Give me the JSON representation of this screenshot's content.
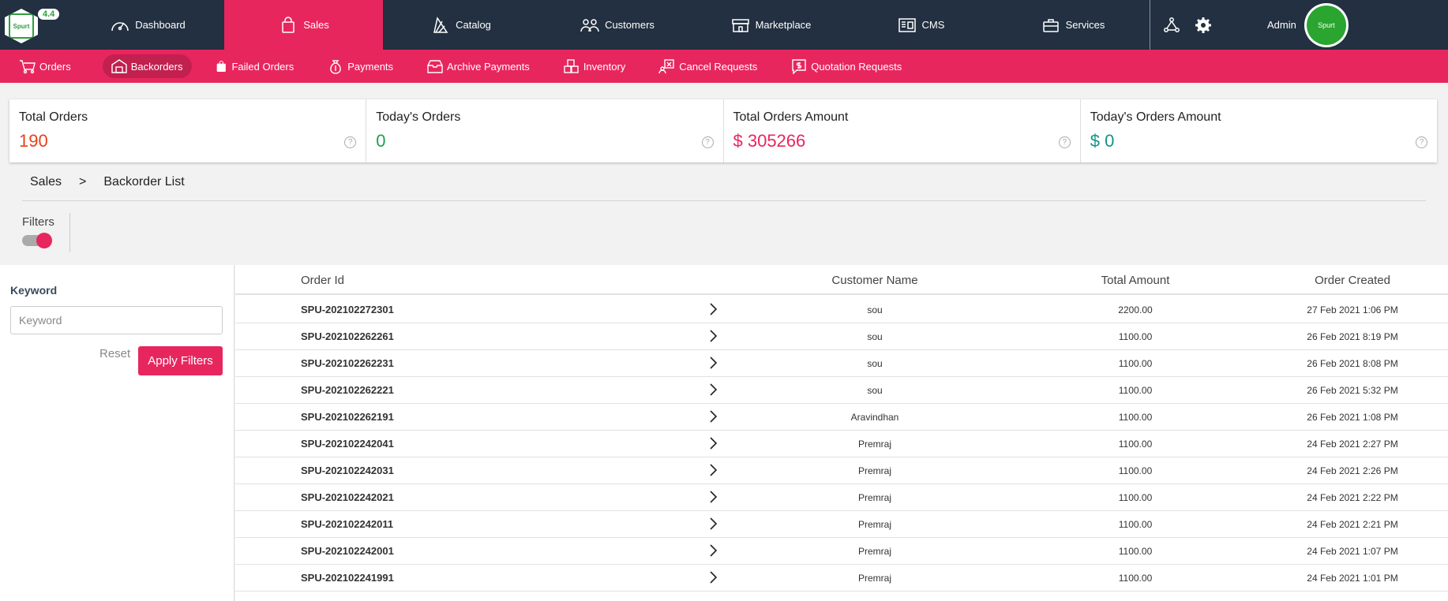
{
  "app": {
    "version": "4.4",
    "logo_text": "Spurt"
  },
  "topnav": {
    "items": [
      {
        "label": "Dashboard",
        "icon": "speedometer-icon"
      },
      {
        "label": "Sales",
        "icon": "shopping-bag-icon",
        "active": true
      },
      {
        "label": "Catalog",
        "icon": "catalog-icon"
      },
      {
        "label": "Customers",
        "icon": "users-icon"
      },
      {
        "label": "Marketplace",
        "icon": "store-icon"
      },
      {
        "label": "CMS",
        "icon": "cms-icon"
      },
      {
        "label": "Services",
        "icon": "briefcase-icon"
      }
    ],
    "user": {
      "name": "Admin"
    }
  },
  "subnav": {
    "items": [
      {
        "label": "Orders",
        "icon": "cart-icon"
      },
      {
        "label": "Backorders",
        "icon": "warehouse-icon",
        "active": true
      },
      {
        "label": "Failed Orders",
        "icon": "bag-icon"
      },
      {
        "label": "Payments",
        "icon": "money-bag-icon"
      },
      {
        "label": "Archive Payments",
        "icon": "archive-icon"
      },
      {
        "label": "Inventory",
        "icon": "boxes-icon"
      },
      {
        "label": "Cancel Requests",
        "icon": "cancel-request-icon"
      },
      {
        "label": "Quotation Requests",
        "icon": "quotation-icon"
      }
    ]
  },
  "stats": [
    {
      "label": "Total Orders",
      "value": "190",
      "color": "#e8401c"
    },
    {
      "label": "Today's Orders",
      "value": "0",
      "color": "#1aa34a"
    },
    {
      "label": "Total Orders Amount",
      "value": "$ 305266",
      "color": "#e8265e"
    },
    {
      "label": "Today's Orders Amount",
      "value": "$ 0",
      "color": "#14948a"
    }
  ],
  "breadcrumb": {
    "root": "Sales",
    "separator": ">",
    "current": "Backorder List"
  },
  "filters": {
    "toggle_label": "Filters",
    "keyword_label": "Keyword",
    "keyword_placeholder": "Keyword",
    "reset_label": "Reset",
    "apply_label": "Apply Filters"
  },
  "table": {
    "columns": [
      "Order Id",
      "Customer Name",
      "Total Amount",
      "Order Created"
    ],
    "rows": [
      {
        "id": "SPU-202102272301",
        "customer": "sou",
        "amount": "2200.00",
        "created": "27 Feb 2021 1:06 PM"
      },
      {
        "id": "SPU-202102262261",
        "customer": "sou",
        "amount": "1100.00",
        "created": "26 Feb 2021 8:19 PM"
      },
      {
        "id": "SPU-202102262231",
        "customer": "sou",
        "amount": "1100.00",
        "created": "26 Feb 2021 8:08 PM"
      },
      {
        "id": "SPU-202102262221",
        "customer": "sou",
        "amount": "1100.00",
        "created": "26 Feb 2021 5:32 PM"
      },
      {
        "id": "SPU-202102262191",
        "customer": "Aravindhan",
        "amount": "1100.00",
        "created": "26 Feb 2021 1:08 PM"
      },
      {
        "id": "SPU-202102242041",
        "customer": "Premraj",
        "amount": "1100.00",
        "created": "24 Feb 2021 2:27 PM"
      },
      {
        "id": "SPU-202102242031",
        "customer": "Premraj",
        "amount": "1100.00",
        "created": "24 Feb 2021 2:26 PM"
      },
      {
        "id": "SPU-202102242021",
        "customer": "Premraj",
        "amount": "1100.00",
        "created": "24 Feb 2021 2:22 PM"
      },
      {
        "id": "SPU-202102242011",
        "customer": "Premraj",
        "amount": "1100.00",
        "created": "24 Feb 2021 2:21 PM"
      },
      {
        "id": "SPU-202102242001",
        "customer": "Premraj",
        "amount": "1100.00",
        "created": "24 Feb 2021 1:07 PM"
      },
      {
        "id": "SPU-202102241991",
        "customer": "Premraj",
        "amount": "1100.00",
        "created": "24 Feb 2021 1:01 PM"
      }
    ]
  }
}
